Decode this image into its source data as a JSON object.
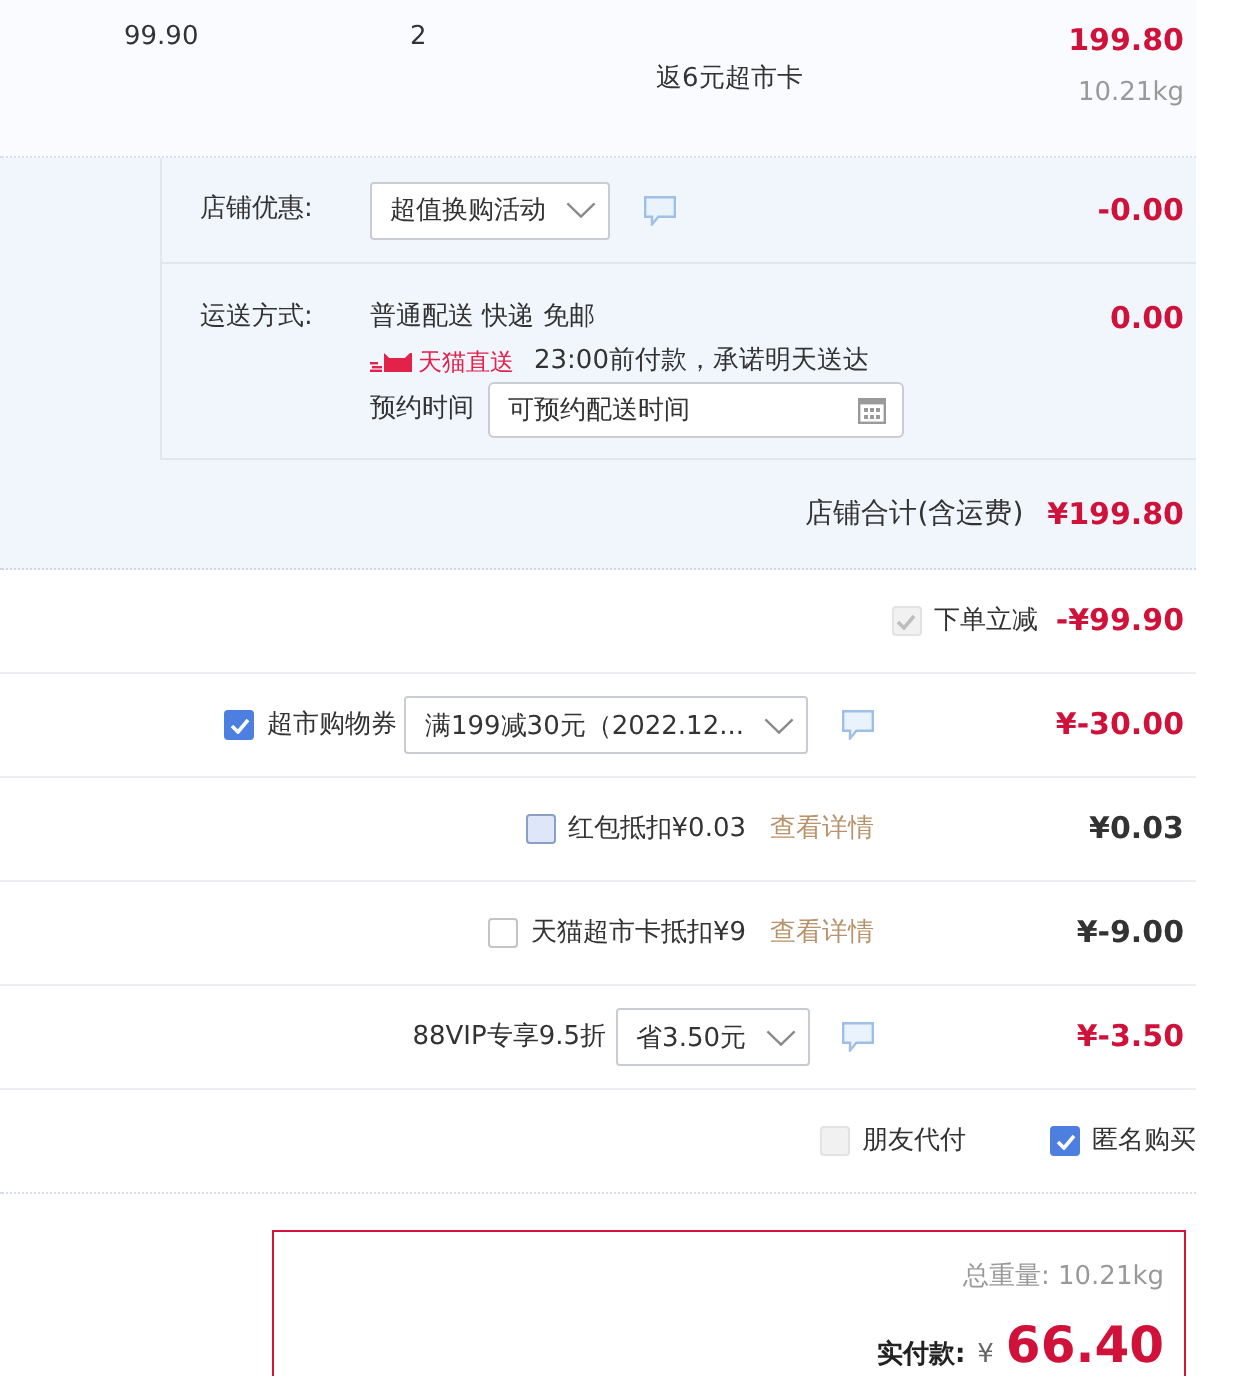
{
  "item": {
    "unit_price": "99.90",
    "quantity": "2",
    "promotion": "返6元超市卡",
    "subtotal": "199.80",
    "weight": "10.21kg"
  },
  "store": {
    "discount": {
      "label": "店铺优惠:",
      "option": "超值换购活动",
      "amount": "-0.00"
    },
    "shipping": {
      "label": "运送方式:",
      "method": "普通配送 快递 免邮",
      "amount": "0.00",
      "badge": "天猫直送",
      "promise": "23:00前付款，承诺明天送达",
      "appointment_label": "预约时间",
      "appointment_field": {
        "placeholder": "可预约配送时间"
      }
    },
    "total": {
      "label": "店铺合计(含运费)",
      "amount": "¥199.80"
    }
  },
  "adjustments": [
    {
      "kind": "instant",
      "checkbox": {
        "checked": true,
        "disabled": true,
        "focused": false
      },
      "label": "下单立减",
      "amount": "-¥99.90",
      "applied": true
    },
    {
      "kind": "voucher",
      "checkbox": {
        "checked": true,
        "disabled": false,
        "focused": false
      },
      "label": "超市购物券",
      "option": "满199减30元（2022.12...",
      "amount": "¥-30.00",
      "applied": true
    },
    {
      "kind": "deduction",
      "checkbox": {
        "checked": false,
        "disabled": false,
        "focused": true
      },
      "label": "红包抵扣¥0.03",
      "link": "查看详情",
      "amount": "¥0.03",
      "applied": false
    },
    {
      "kind": "deduction",
      "checkbox": {
        "checked": false,
        "disabled": false,
        "focused": false
      },
      "label": "天猫超市卡抵扣¥9",
      "link": "查看详情",
      "amount": "¥-9.00",
      "applied": false
    },
    {
      "kind": "offer",
      "label": "88VIP专享9.5折",
      "option": "省3.50元",
      "amount": "¥-3.50",
      "applied": true
    }
  ],
  "extra_options": [
    {
      "label": "朋友代付",
      "checked": false,
      "disabled": true
    },
    {
      "label": "匿名购买",
      "checked": true,
      "disabled": false
    }
  ],
  "payment": {
    "weight": "总重量: 10.21kg",
    "label": "实付款:",
    "currency": "¥",
    "amount": "66.40"
  }
}
